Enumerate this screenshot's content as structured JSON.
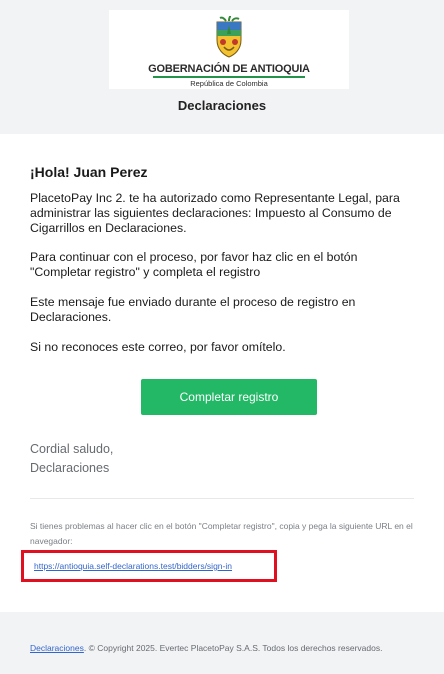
{
  "header": {
    "logo": {
      "name": "GOBERNACIÓN DE ANTIOQUIA",
      "subtitle": "República de Colombia"
    },
    "brand_title": "Declaraciones"
  },
  "email": {
    "greeting": "¡Hola! Juan Perez",
    "paragraphs": [
      "PlacetoPay Inc 2. te ha autorizado como Representante Legal, para administrar las siguientes declaraciones: Impuesto al Consumo de Cigarrillos en Declaraciones.",
      "Para continuar con el proceso, por favor haz clic en el botón \"Completar registro\" y completa el registro",
      "Este mensaje fue enviado durante el proceso de registro en Declaraciones.",
      "Si no reconoces este correo, por favor omítelo."
    ],
    "cta_label": "Completar registro",
    "closing": "Cordial saludo,",
    "signature": "Declaraciones",
    "help_text": "Si tienes problemas al hacer clic en el botón \"Completar registro\", copia y pega la siguiente URL en el navegador:",
    "url": "https://antioquia.self-declarations.test/bidders/sign-in"
  },
  "footer": {
    "link_label": "Declaraciones",
    "copyright": ". © Copyright 2025. Evertec PlacetoPay S.A.S. Todos los derechos reservados."
  },
  "colors": {
    "button": "#22b866",
    "link": "#3366cc",
    "highlight": "#e01020",
    "underline": "#23934a"
  }
}
